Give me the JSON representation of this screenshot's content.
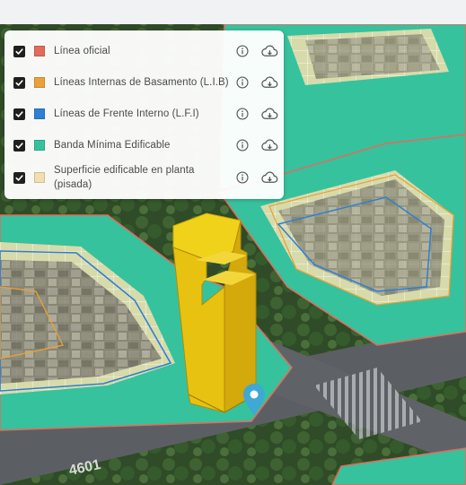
{
  "colors": {
    "linea_oficial": "#e36b5c",
    "lib": "#eba13a",
    "lfi": "#2f7fd2",
    "banda": "#36c29d",
    "superficie": "#f3dfae",
    "building": "#e8c210",
    "marker": "#3fa8d4"
  },
  "legend": {
    "items": [
      {
        "label": "Línea oficial",
        "swatch_color": "#e36b5c",
        "checked": true
      },
      {
        "label": "Líneas Internas de Basamento (L.I.B)",
        "swatch_color": "#eba13a",
        "checked": true
      },
      {
        "label": "Líneas de Frente Interno (L.F.I)",
        "swatch_color": "#2f7fd2",
        "checked": true
      },
      {
        "label": "Banda Mínima Edificable",
        "swatch_color": "#36c29d",
        "checked": true
      },
      {
        "label": "Superficie edificable en planta (pisada)",
        "swatch_color": "#f3dfae",
        "checked": true
      }
    ],
    "info_icon": "info-icon",
    "download_icon": "cloud-download-icon"
  },
  "map": {
    "street_number": "4601",
    "marker_icon": "map-pin-icon"
  }
}
